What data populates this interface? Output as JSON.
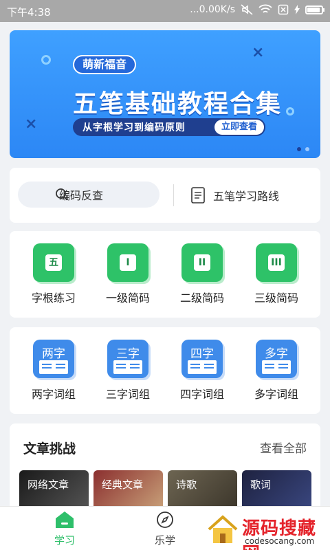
{
  "status_bar": {
    "time": "下午4:38",
    "network_speed": "...0.00K/s",
    "battery_level": 0.9
  },
  "banner": {
    "tag": "萌新福音",
    "title": "五笔基础教程合集",
    "subtitle": "从字根学习到编码原则",
    "button": "立即查看",
    "page_count": 2,
    "active_page": 1
  },
  "tools": {
    "search_label": "编码反查",
    "route_label": "五笔学习路线"
  },
  "practice": [
    {
      "glyph": "五",
      "label": "字根练习"
    },
    {
      "glyph": "I",
      "label": "一级简码"
    },
    {
      "glyph": "II",
      "label": "二级简码"
    },
    {
      "glyph": "III",
      "label": "三级简码"
    }
  ],
  "words": [
    {
      "glyph": "两字",
      "label": "两字词组"
    },
    {
      "glyph": "三字",
      "label": "三字词组"
    },
    {
      "glyph": "四字",
      "label": "四字词组"
    },
    {
      "glyph": "多字",
      "label": "多字词组"
    }
  ],
  "articles": {
    "title": "文章挑战",
    "more": "查看全部",
    "tiles": [
      "网络文章",
      "经典文章",
      "诗歌",
      "歌词"
    ]
  },
  "tab_bar": {
    "learn": "学习",
    "fun": "乐学"
  },
  "watermark": {
    "main": "源码搜藏网",
    "url": "codesocang.com"
  },
  "colors": {
    "accent_green": "#2ec268",
    "accent_blue": "#3f8bea",
    "banner_blue": "#2c87f5"
  }
}
